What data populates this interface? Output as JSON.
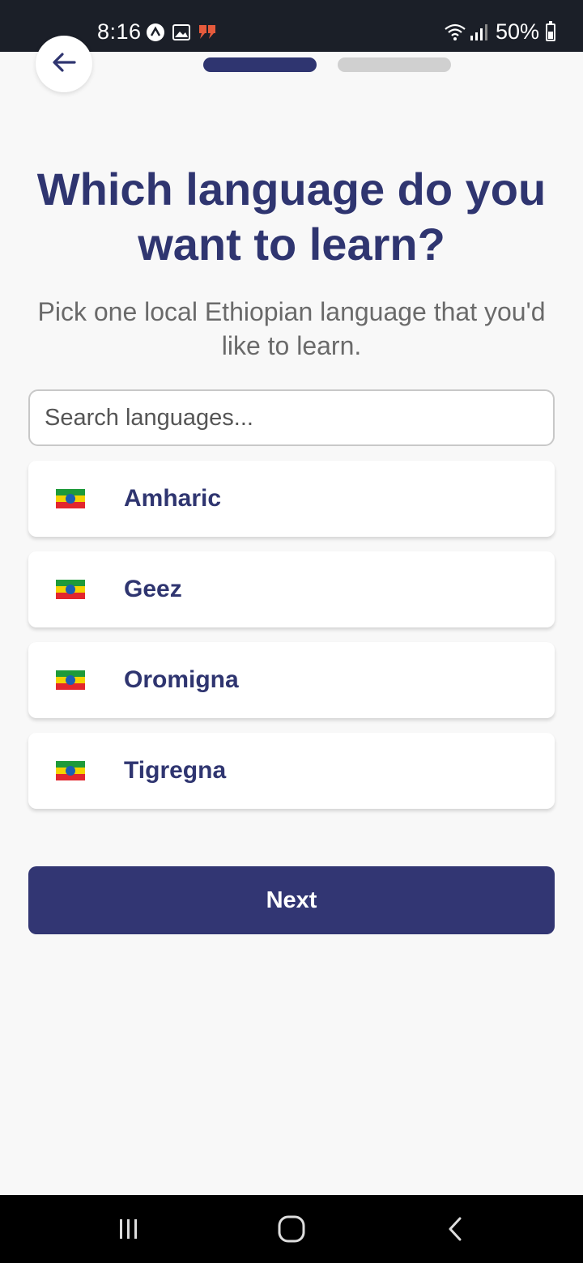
{
  "status_bar": {
    "time": "8:16",
    "battery_text": "50%",
    "battery_level": 0.5,
    "icons_left": [
      "app-icon",
      "gallery-icon",
      "quote-icon"
    ],
    "icons_right": [
      "wifi-icon",
      "signal-icon",
      "battery-icon"
    ]
  },
  "header": {
    "back_icon": "arrow-left-icon",
    "progress": {
      "current_step": 1,
      "total_steps": 2
    }
  },
  "main": {
    "title": "Which language do you want to learn?",
    "subtitle": "Pick one local Ethiopian language that you'd like to learn.",
    "search": {
      "placeholder": "Search languages...",
      "value": ""
    },
    "languages": [
      {
        "label": "Amharic",
        "flag": "ethiopia-flag-icon"
      },
      {
        "label": "Geez",
        "flag": "ethiopia-flag-icon"
      },
      {
        "label": "Oromigna",
        "flag": "ethiopia-flag-icon"
      },
      {
        "label": "Tigregna",
        "flag": "ethiopia-flag-icon"
      }
    ],
    "next_label": "Next"
  },
  "nav_bar": {
    "icons": [
      "recent-apps-icon",
      "home-icon",
      "back-nav-icon"
    ]
  },
  "colors": {
    "primary": "#323673",
    "text_primary": "#2f3570",
    "text_secondary": "#6a6a6a",
    "background": "#f8f8f8",
    "progress_inactive": "#d0d0d0"
  }
}
